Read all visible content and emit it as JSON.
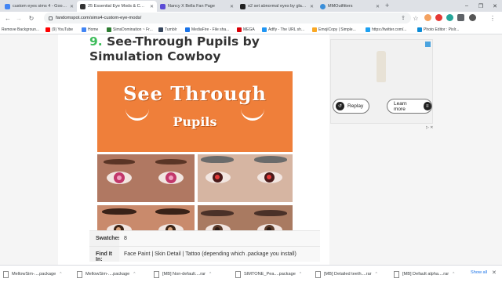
{
  "browser": {
    "tabs": [
      {
        "title": "custom eyes sims 4 - Google Se...",
        "color": "#4285f4",
        "active": false
      },
      {
        "title": "25 Essential Eye Mods & CC Pac...",
        "color": "#333333",
        "active": true
      },
      {
        "title": "Nancy X Bella Fan Page",
        "color": "#5b4bd6",
        "active": false
      },
      {
        "title": "o2 set abnormal eyes by glaza |...",
        "color": "#222222",
        "active": false
      },
      {
        "title": "MMOutfitters",
        "color": "#3b8fd9",
        "active": false
      }
    ],
    "new_tab": "+",
    "window_controls": [
      "–",
      "❐",
      "✕"
    ],
    "url": "fandomspot.com/sims4-custom-eye-mods/",
    "bookmarks": [
      {
        "label": "Remove Backgroun...",
        "color": "#ffffff"
      },
      {
        "label": "(9) YouTube",
        "color": "#ff0000"
      },
      {
        "label": "Home",
        "color": "#4285f4"
      },
      {
        "label": "SimsDomination ~ Fr...",
        "color": "#2e7d32"
      },
      {
        "label": "Tumblr",
        "color": "#36465d"
      },
      {
        "label": "MediaFire - File sha...",
        "color": "#1a73e8"
      },
      {
        "label": "MEGA",
        "color": "#d90007"
      },
      {
        "label": "Adfly - The URL sh...",
        "color": "#2196f3"
      },
      {
        "label": "EmojiCopy | Simple...",
        "color": "#f9a825"
      },
      {
        "label": "https://twitter.com/...",
        "color": "#1da1f2"
      },
      {
        "label": "Photo Editor : Pixlr...",
        "color": "#0b8bd6"
      }
    ]
  },
  "article": {
    "number": "9.",
    "title_line1": "See-Through Pupils by",
    "title_line2": "Simulation Cowboy",
    "banner_title": "See Through",
    "banner_sub": "Pupils",
    "table": [
      {
        "key": "Swatches:",
        "value": "8"
      },
      {
        "key": "Find It In:",
        "value": "Face Paint | Skin Detail | Tattoo (depending which .package you install)"
      }
    ]
  },
  "ad": {
    "replay_label": "Replay",
    "learn_label": "Learn more",
    "adchoices": "▷ ✕"
  },
  "downloads": {
    "items": [
      "MellowSim-....package",
      "MellowSim-....package",
      "[MB] Non-default....rar",
      "SIMTONE_Pea....package",
      "[MB] Detailed teeth....rar",
      "[MB] Default alpha....rar"
    ],
    "show_all": "Show all",
    "close": "✕"
  }
}
